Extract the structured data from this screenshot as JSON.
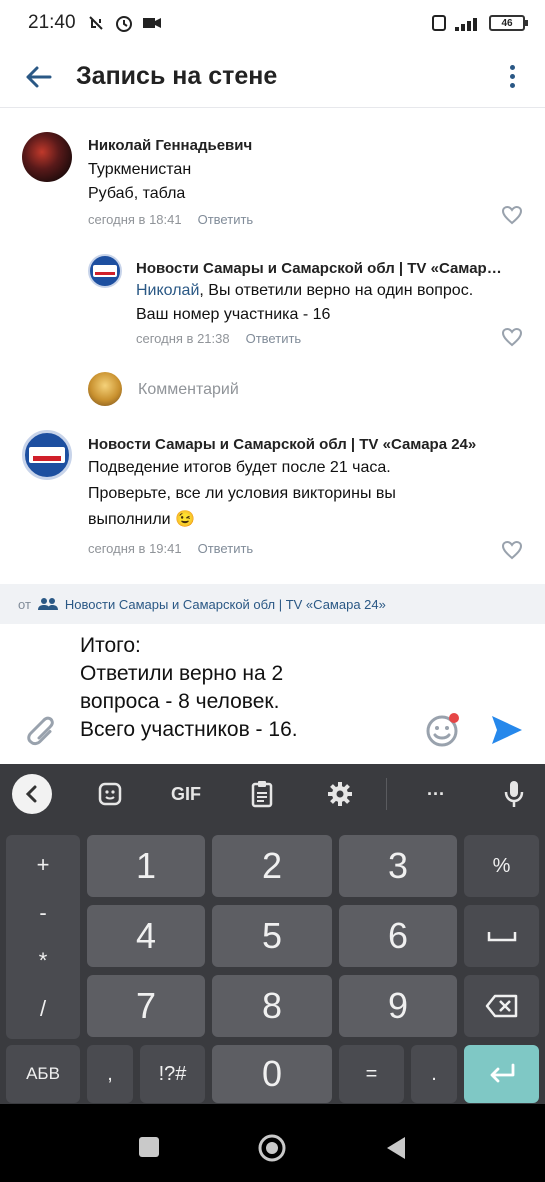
{
  "status_bar": {
    "time": "21:40",
    "battery": "46"
  },
  "app_bar": {
    "title": "Запись на стене"
  },
  "comments": [
    {
      "author": "Николай Геннадьевич",
      "lines": [
        "Туркменистан",
        "Рубаб, табла"
      ],
      "time": "сегодня в 18:41",
      "reply": "Ответить"
    },
    {
      "author": "Новости Самары и Самарской обл | TV «Самар…",
      "mention": "Николай",
      "text_after_mention": ", Вы ответили верно на один вопрос.",
      "line2": "Ваш номер участника - 16",
      "time": "сегодня в 21:38",
      "reply": "Ответить"
    },
    {
      "author": "Новости Самары и Самарской обл | TV «Самара 24»",
      "lines": [
        "Подведение итогов будет после 21 часа.",
        "Проверьте, все ли условия викторины вы",
        "выполнили 😉"
      ],
      "time": "сегодня в 19:41",
      "reply": "Ответить"
    }
  ],
  "comment_input_placeholder": "Комментарий",
  "source": {
    "prefix": "от",
    "name": "Новости Самары и Самарской обл | TV «Самара 24»"
  },
  "composer": {
    "value": "Итого:\nОтветили верно на 2\nвопроса - 8 человек.\nВсего участников - 16."
  },
  "keyboard": {
    "toolbar": {
      "gif": "GIF",
      "more": "···"
    },
    "digits": [
      "1",
      "2",
      "3",
      "4",
      "5",
      "6",
      "7",
      "8",
      "9",
      "0"
    ],
    "side_symbols": [
      "+",
      "-",
      "*",
      "/"
    ],
    "percent": "%",
    "lang": "АБВ",
    "comma": ",",
    "symbols": "!?#",
    "equals": "=",
    "dot": "."
  },
  "colors": {
    "accent": "#2a5885",
    "keyboard_bg": "#3a3b3f",
    "key_bg": "#5d5e63",
    "enter_key": "#7fc8c5"
  }
}
